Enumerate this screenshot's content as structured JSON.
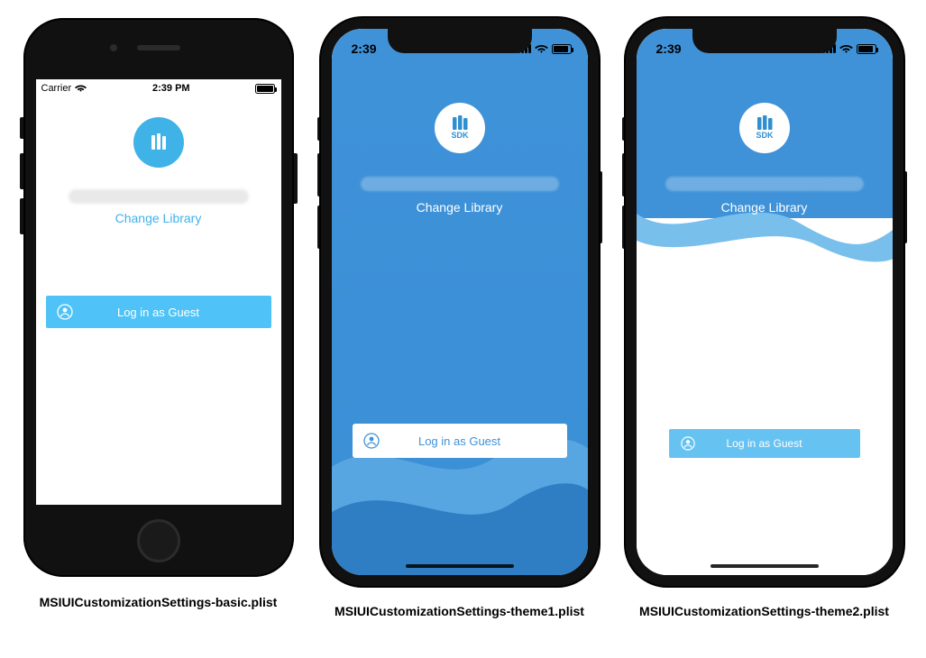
{
  "phones": {
    "basic": {
      "status": {
        "carrier": "Carrier",
        "time": "2:39 PM"
      },
      "logo_label": "",
      "change_library": "Change Library",
      "guest_button": "Log in as Guest",
      "caption": "MSIUICustomizationSettings-basic.plist"
    },
    "theme1": {
      "status": {
        "time": "2:39"
      },
      "logo_label": "SDK",
      "change_library": "Change Library",
      "guest_button": "Log in as Guest",
      "caption": "MSIUICustomizationSettings-theme1.plist"
    },
    "theme2": {
      "status": {
        "time": "2:39"
      },
      "logo_label": "SDK",
      "change_library": "Change Library",
      "guest_button": "Log in as Guest",
      "caption": "MSIUICustomizationSettings-theme2.plist"
    }
  },
  "colors": {
    "accent_light": "#4fc3f7",
    "accent_blue": "#3f92d8",
    "wave1": "#5ba9e2",
    "wave2": "#2f7ec4"
  }
}
